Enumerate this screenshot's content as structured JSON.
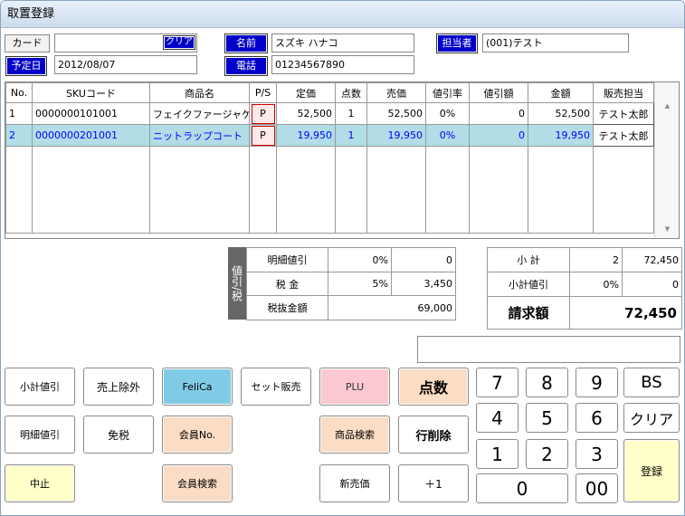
{
  "window": {
    "title": "取置登録"
  },
  "header": {
    "card_label": "カード",
    "card_value": "",
    "card_clear_label": "クリア",
    "name_label": "名前",
    "name_value": "スズキ ハナコ",
    "staff_label": "担当者",
    "staff_value": "(001)テスト",
    "date_label": "予定日",
    "date_value": "2012/08/07",
    "phone_label": "電話",
    "phone_value": "01234567890"
  },
  "table": {
    "columns": [
      "No.",
      "SKUコード",
      "商品名",
      "P/S",
      "定価",
      "点数",
      "売価",
      "値引率",
      "値引額",
      "金額",
      "販売担当"
    ],
    "rows": [
      {
        "no": "1",
        "sku": "0000000101001",
        "name": "フェイクファージャケッ…",
        "ps": "P",
        "list_price": "52,500",
        "qty": "1",
        "price": "52,500",
        "disc_rate": "0%",
        "disc_amt": "0",
        "amount": "52,500",
        "staff": "テスト太郎"
      },
      {
        "no": "2",
        "sku": "0000000201001",
        "name": "ニットラップコート",
        "ps": "P",
        "list_price": "19,950",
        "qty": "1",
        "price": "19,950",
        "disc_rate": "0%",
        "disc_amt": "0",
        "amount": "19,950",
        "staff": "テスト太郎"
      }
    ],
    "selected_row": 2,
    "scroll_up": "▲",
    "scroll_down": "▼"
  },
  "tax_panel": {
    "side_label": "値引/税",
    "rows": [
      {
        "label": "明細値引",
        "rate": "0%",
        "value": "0"
      },
      {
        "label": "税 金",
        "rate": "5%",
        "value": "3,450"
      },
      {
        "label": "税抜金額",
        "rate": "",
        "value": "69,000"
      }
    ]
  },
  "totals": {
    "subtotal_label": "小 計",
    "subtotal_qty": "2",
    "subtotal_amount": "72,450",
    "subtotal_disc_label": "小計値引",
    "subtotal_disc_rate": "0%",
    "subtotal_disc_value": "0",
    "billed_label": "請求額",
    "billed_amount": "72,450"
  },
  "message_box": "",
  "buttons": {
    "subtotal_discount": "小計値引",
    "sale_exclude": "売上除外",
    "felica": "FeliCa",
    "set_sale": "セット販売",
    "plu": "PLU",
    "quantity": "点数",
    "line_discount": "明細値引",
    "tax_free": "免税",
    "member_no": "会員No.",
    "product_search": "商品検索",
    "delete_line": "行削除",
    "cancel": "中止",
    "member_search": "会員検索",
    "new_price": "新売価",
    "plus_one": "＋1",
    "register": "登録"
  },
  "keypad": {
    "k7": "7",
    "k8": "8",
    "k9": "9",
    "bs": "BS",
    "k4": "4",
    "k5": "5",
    "k6": "6",
    "clear": "クリア",
    "k1": "1",
    "k2": "2",
    "k3": "3",
    "k0": "0",
    "k00": "00"
  },
  "colors": {
    "selected_row": "#b0dde6",
    "blue_label": "#0000c8",
    "felica": "#7fcbe6",
    "pink": "#fbc9cf",
    "peach": "#fbdcc4",
    "yellow": "#ffffc8"
  }
}
